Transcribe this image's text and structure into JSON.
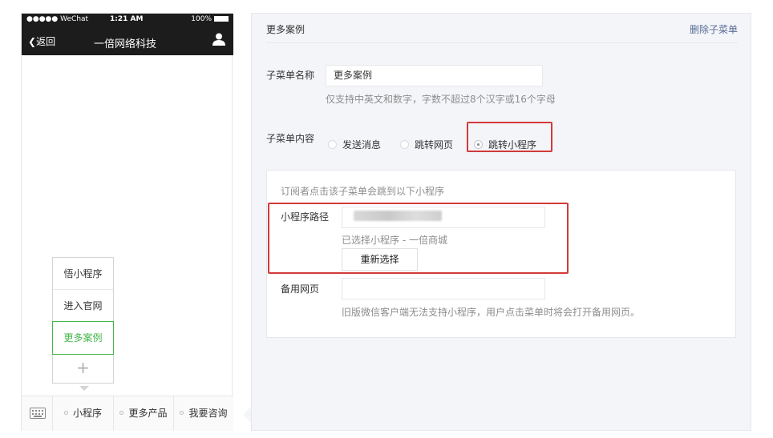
{
  "phone": {
    "status": {
      "carrier": "●●●●● WeChat",
      "time": "1:21 AM",
      "battery": "100%"
    },
    "nav": {
      "back_label": "返回",
      "title": "一倍网络科技"
    },
    "submenu": {
      "items": [
        "悟小程序",
        "进入官网",
        "更多案例"
      ],
      "add_label": "+"
    },
    "bottom_tabs": [
      "小程序",
      "更多产品",
      "我要咨询"
    ]
  },
  "editor": {
    "header_title": "更多案例",
    "delete_label": "删除子菜单",
    "name_label": "子菜单名称",
    "name_value": "更多案例",
    "name_hint": "仅支持中英文和数字，字数不超过8个汉字或16个字母",
    "content_label": "子菜单内容",
    "content_options": [
      "发送消息",
      "跳转网页",
      "跳转小程序"
    ],
    "selected_option": "跳转小程序",
    "inner": {
      "intro": "订阅者点击该子菜单会跳到以下小程序",
      "path_label": "小程序路径",
      "path_hint": "已选择小程序 - 一倍商城",
      "reselect_label": "重新选择",
      "backup_label": "备用网页",
      "backup_value": "",
      "backup_hint": "旧版微信客户端无法支持小程序，用户点击菜单时将会打开备用网页。"
    }
  },
  "colors": {
    "accent_green": "#44b549",
    "link_blue": "#576b95",
    "highlight_red": "#d13a3a"
  }
}
